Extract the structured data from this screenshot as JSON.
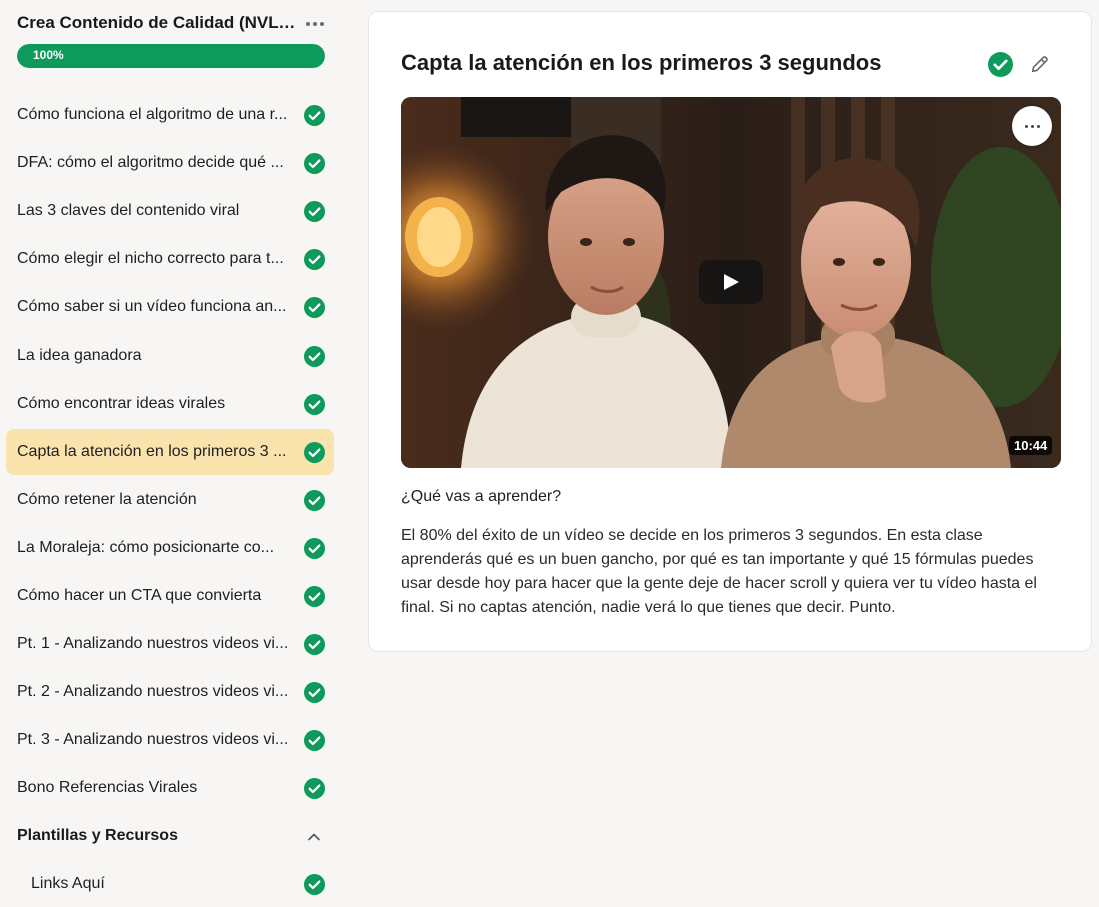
{
  "sidebar": {
    "course_title": "Crea Contenido de Calidad (NVL ...",
    "progress": {
      "label": "100%",
      "percent": 100
    },
    "lessons": [
      {
        "label": "Cómo funciona el algoritmo de una r...",
        "completed": true
      },
      {
        "label": "DFA: cómo el algoritmo decide qué ...",
        "completed": true
      },
      {
        "label": "Las 3 claves del contenido viral",
        "completed": true
      },
      {
        "label": "Cómo elegir el nicho correcto para t...",
        "completed": true
      },
      {
        "label": "Cómo saber si un vídeo funciona an...",
        "completed": true
      },
      {
        "label": "La idea ganadora",
        "completed": true
      },
      {
        "label": "Cómo encontrar ideas virales",
        "completed": true
      },
      {
        "label": "Capta la atención en los primeros 3 ...",
        "completed": true,
        "active": true
      },
      {
        "label": "Cómo retener la atención",
        "completed": true
      },
      {
        "label": "La Moraleja: cómo posicionarte co...",
        "completed": true
      },
      {
        "label": "Cómo hacer un CTA que convierta",
        "completed": true
      },
      {
        "label": "Pt. 1 - Analizando nuestros videos vi...",
        "completed": true
      },
      {
        "label": "Pt. 2 - Analizando nuestros videos vi...",
        "completed": true
      },
      {
        "label": "Pt. 3 - Analizando nuestros videos vi...",
        "completed": true
      },
      {
        "label": "Bono Referencias Virales",
        "completed": true
      }
    ],
    "section": {
      "label": "Plantillas y Recursos",
      "expanded": true,
      "icon": "chevron-up-icon"
    },
    "section_lessons": [
      {
        "label": "Links Aquí",
        "completed": true
      }
    ]
  },
  "main": {
    "title": "Capta la atención en los primeros 3 segundos",
    "completed": true,
    "video": {
      "duration": "10:44"
    },
    "subheading": "¿Qué vas a aprender?",
    "description": "El 80% del éxito de un vídeo se decide en los primeros 3 segundos. En esta clase aprenderás qué es un buen gancho, por qué es tan importante y qué 15 fórmulas puedes usar desde hoy para hacer que la gente deje de hacer scroll y quiera ver tu vídeo hasta el final. Si no captas atención, nadie verá lo que tienes que decir. Punto."
  },
  "colors": {
    "accent_green": "#0d9a5a",
    "active_highlight": "#fbe3ad",
    "background": "#f7f6f4"
  }
}
